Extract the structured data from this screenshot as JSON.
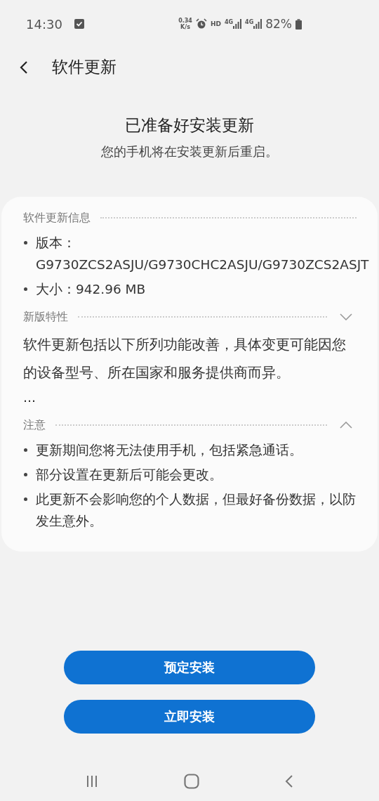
{
  "status_bar": {
    "time": "14:30",
    "speed_value": "0.34",
    "speed_unit": "K/s",
    "network_1": "4G",
    "network_2": "4G",
    "hd": "HD",
    "battery": "82%"
  },
  "header": {
    "title": "软件更新"
  },
  "intro": {
    "title": "已准备好安装更新",
    "subtitle": "您的手机将在安装更新后重启。"
  },
  "sections": [
    {
      "kind": "list",
      "title": "软件更新信息",
      "items": [
        "版本：G9730ZCS2ASJU/G9730CHC2ASJU/G9730ZCS2ASJT",
        "大小：942.96 MB"
      ]
    },
    {
      "kind": "text",
      "title": "新版特性",
      "expanded": false,
      "text": "软件更新包括以下所列功能改善，具体变更可能因您的设备型号、所在国家和服务提供商而异。",
      "more": "…"
    },
    {
      "kind": "list",
      "title": "注意",
      "expanded": true,
      "items": [
        "更新期间您将无法使用手机，包括紧急通话。",
        "部分设置在更新后可能会更改。",
        "此更新不会影响您的个人数据，但最好备份数据，以防发生意外。"
      ]
    }
  ],
  "buttons": [
    "预定安装",
    "立即安装"
  ]
}
